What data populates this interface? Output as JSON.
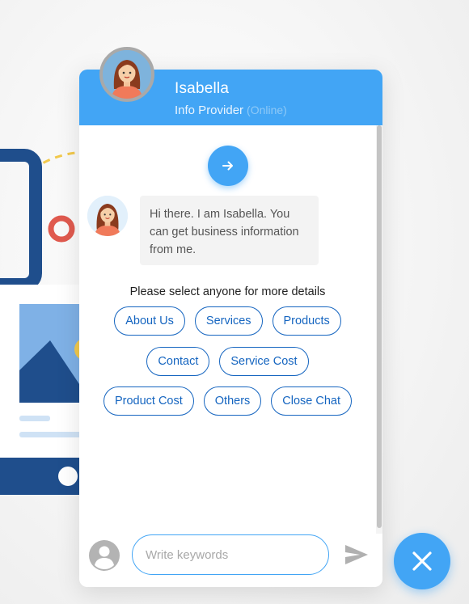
{
  "header": {
    "agent_name": "Isabella",
    "agent_role": "Info Provider",
    "agent_status": "(Online)"
  },
  "conversation": {
    "bot_message": "Hi there. I am Isabella. You can get business information from me.",
    "options_prompt": "Please select anyone for more details",
    "options": [
      "About Us",
      "Services",
      "Products",
      "Contact",
      "Service Cost",
      "Product Cost",
      "Others",
      "Close Chat"
    ]
  },
  "footer": {
    "input_placeholder": "Write keywords",
    "input_value": ""
  },
  "icons": {
    "start": "arrow-right-icon",
    "send": "send-icon",
    "user": "user-icon",
    "close": "close-icon"
  },
  "colors": {
    "primary": "#42a5f5",
    "chip_text": "#1565c0",
    "bubble_bg": "#f3f3f3"
  }
}
